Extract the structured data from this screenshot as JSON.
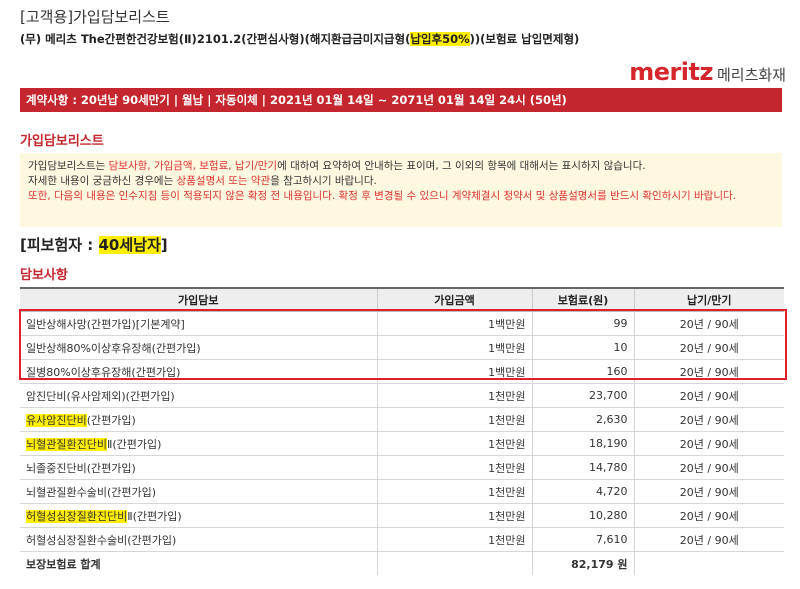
{
  "header": {
    "doc_type": "[고객용]가입담보리스트",
    "product_prefix": "(무) 메리츠 The간편한건강보험(Ⅱ)2101.2(간편심사형)(해지환급금미지급형(",
    "product_highlight": "납입후50%",
    "product_suffix": "))(보험료 납입면제형)"
  },
  "logo": {
    "brand": "meritz",
    "name": "메리츠화재"
  },
  "contract": {
    "text": "계약사항 : 20년납 90세만기 | 월납 | 자동이체 | 2021년 01월 14일 ~ 2071년 01월 14일 24시 (50년)"
  },
  "section_list": {
    "title": "가입담보리스트"
  },
  "notice": {
    "line1_a": "가입담보리스트는 ",
    "line1_b": "담보사항, 가입금액, 보험료, 납기/만기",
    "line1_c": "에 대하여 요약하여 안내하는 표이며, 그 이외의 항목에 대해서는 표시하지 않습니다.",
    "line2_a": "자세한 내용이 궁금하신 경우에는 ",
    "line2_b": "상품설명서 또는 약관",
    "line2_c": "을 참고하시기 바랍니다.",
    "line3": "또한, 다음의 내용은 인수지침 등이 적용되지 않은 확정 전 내용입니다. 확정 후 변경될 수 있으니 계약체결시 청약서 및 상품설명서를 반드시 확인하시기 바랍니다."
  },
  "insured": {
    "prefix": "[피보험자 : ",
    "value": "40세남자",
    "suffix": "]"
  },
  "section_coverage": {
    "title": "담보사항"
  },
  "table": {
    "headers": [
      "가입담보",
      "가입금액",
      "보험료(원)",
      "납기/만기"
    ],
    "rows": [
      {
        "hl": "",
        "name": "일반상해사망(간편가입)[기본계약]",
        "amount": "1백만원",
        "premium": "99",
        "term": "20년 / 90세"
      },
      {
        "hl": "",
        "name": "일반상해80%이상후유장해(간편가입)",
        "amount": "1백만원",
        "premium": "10",
        "term": "20년 / 90세"
      },
      {
        "hl": "",
        "name": "질병80%이상후유장해(간편가입)",
        "amount": "1백만원",
        "premium": "160",
        "term": "20년 / 90세"
      },
      {
        "hl": "",
        "name": "암진단비(유사암제외)(간편가입)",
        "amount": "1천만원",
        "premium": "23,700",
        "term": "20년 / 90세"
      },
      {
        "hl": "유사암진단비",
        "name": "(간편가입)",
        "amount": "1천만원",
        "premium": "2,630",
        "term": "20년 / 90세"
      },
      {
        "hl": "뇌혈관질환진단비",
        "name": "Ⅱ(간편가입)",
        "amount": "1천만원",
        "premium": "18,190",
        "term": "20년 / 90세"
      },
      {
        "hl": "",
        "name": "뇌졸중진단비(간편가입)",
        "amount": "1천만원",
        "premium": "14,780",
        "term": "20년 / 90세"
      },
      {
        "hl": "",
        "name": "뇌혈관질환수술비(간편가입)",
        "amount": "1천만원",
        "premium": "4,720",
        "term": "20년 / 90세"
      },
      {
        "hl": "허혈성심장질환진단비",
        "name": "Ⅱ(간편가입)",
        "amount": "1천만원",
        "premium": "10,280",
        "term": "20년 / 90세"
      },
      {
        "hl": "",
        "name": "허혈성심장질환수술비(간편가입)",
        "amount": "1천만원",
        "premium": "7,610",
        "term": "20년 / 90세"
      }
    ],
    "total_label": "보장보험료 합계",
    "total_value": "82,179 원"
  },
  "colors": {
    "brand_red": "#c5252c",
    "highlight": "#ffee00",
    "notice_bg": "#fff8e1"
  }
}
